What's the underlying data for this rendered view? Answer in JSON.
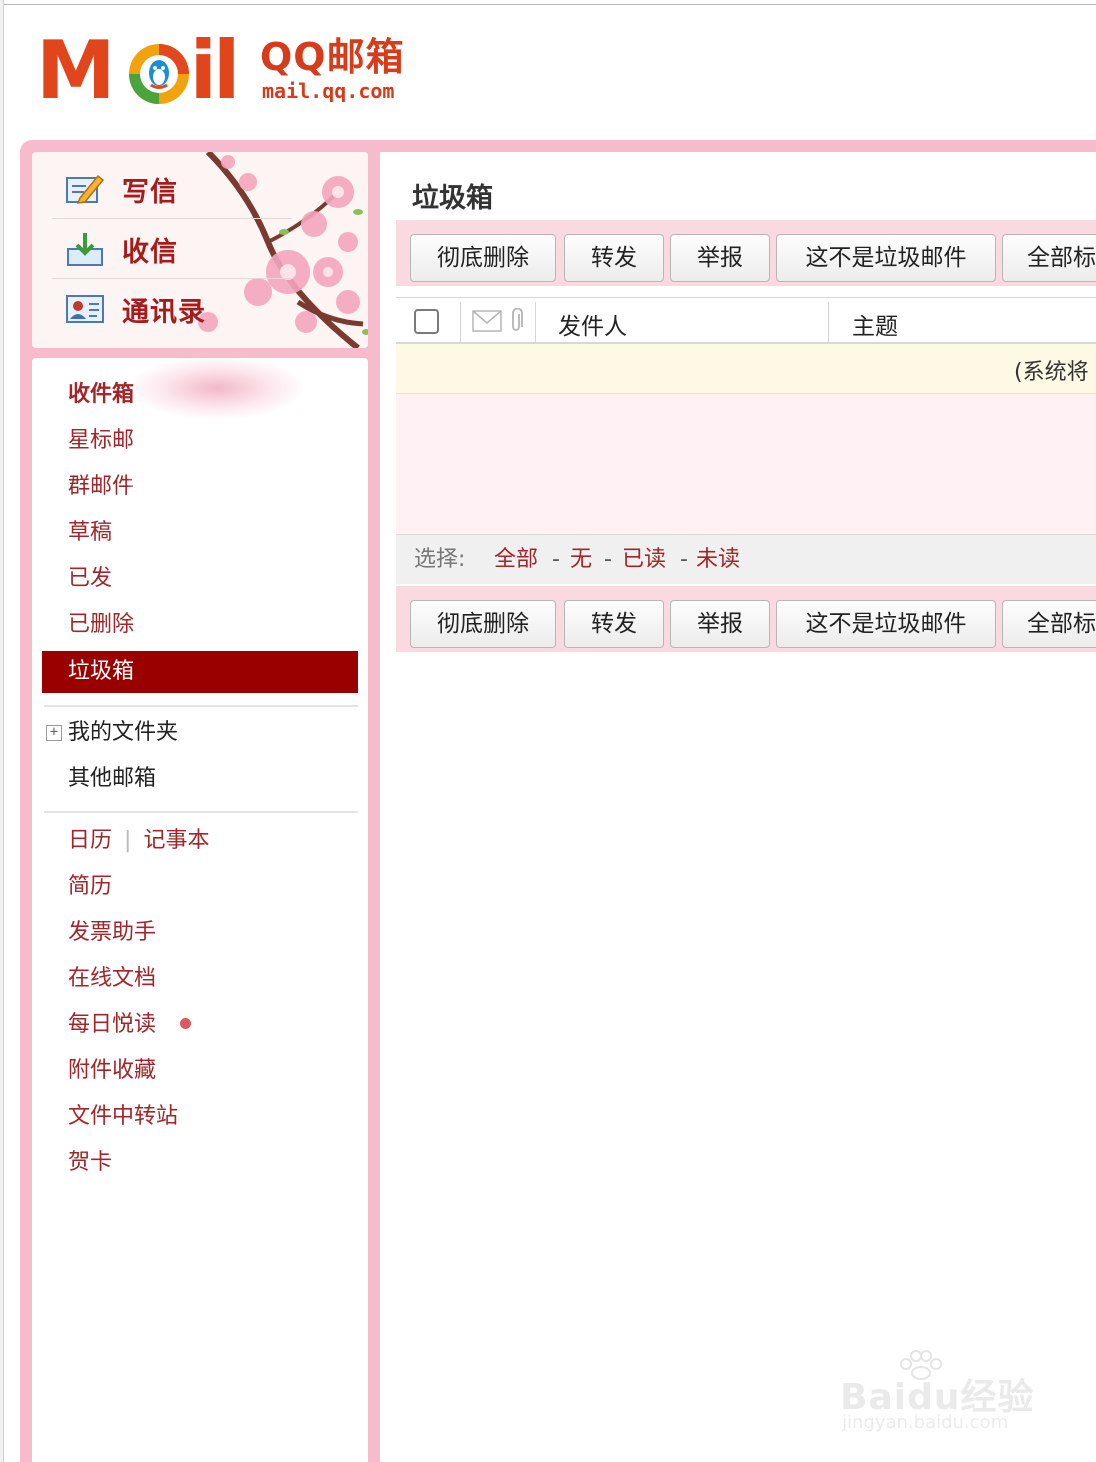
{
  "logo": {
    "wordmark_parts": [
      "M",
      "il"
    ],
    "product_name": "QQ邮箱",
    "url": "mail.qq.com"
  },
  "quick_actions": [
    {
      "label": "写信",
      "icon": "compose-icon"
    },
    {
      "label": "收信",
      "icon": "inbox-download-icon"
    },
    {
      "label": "通讯录",
      "icon": "contacts-card-icon"
    }
  ],
  "folders": {
    "inbox": "收件箱",
    "starred": "星标邮",
    "group": "群邮件",
    "drafts": "草稿",
    "sent": "已发",
    "deleted": "已删除",
    "spam": "垃圾箱",
    "my_folders": "我的文件夹",
    "my_folders_expander": "+",
    "other_mailboxes": "其他邮箱"
  },
  "tools": {
    "calendar": "日历",
    "separator": "|",
    "notebook": "记事本",
    "resume": "简历",
    "invoice": "发票助手",
    "online_docs": "在线文档",
    "daily_reading": "每日悦读",
    "attachments": "附件收藏",
    "file_transfer": "文件中转站",
    "cards": "贺卡"
  },
  "main": {
    "title": "垃圾箱",
    "toolbar_buttons": [
      "彻底删除",
      "转发",
      "举报",
      "这不是垃圾邮件",
      "全部标"
    ],
    "columns": {
      "sender": "发件人",
      "subject": "主题"
    },
    "notice": "(系统将",
    "select": {
      "label": "选择:",
      "all": "全部",
      "none": "无",
      "read": "已读",
      "unread": "未读",
      "dash": "-"
    }
  },
  "watermark": {
    "brand": "Baidu经验",
    "url": "jingyan.baidu.com"
  },
  "colors": {
    "accent": "#990000",
    "frame_pink": "#f6bccd",
    "link_red": "#a0262a",
    "logo_orange": "#e2471e"
  }
}
